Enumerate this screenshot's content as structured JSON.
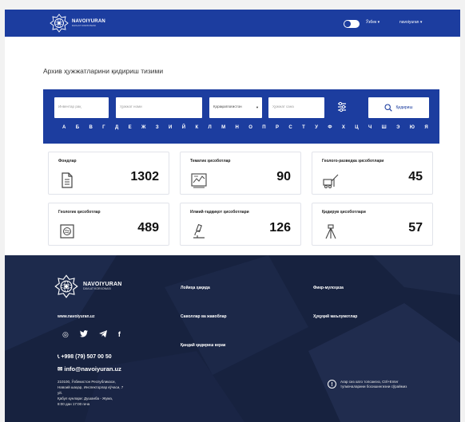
{
  "header": {
    "logo_name": "NAVOIYURAN",
    "logo_subtitle": "DAVLAT KORXONASI",
    "lang_label": "Ўзбек ▾",
    "company_label": "navoiyuran ▾"
  },
  "page_title": "Архив ҳужжатларини қидириш тизими",
  "search": {
    "fields": [
      {
        "placeholder": "Инвентар рақ"
      },
      {
        "placeholder": "Ҳужжат номи"
      },
      {
        "placeholder": "Ҳужжат сана"
      }
    ],
    "select_value": "Қорақалпоғистон",
    "button_label": "Қидириш",
    "letters": [
      "А",
      "Б",
      "В",
      "Г",
      "Д",
      "Е",
      "Ж",
      "З",
      "И",
      "Й",
      "К",
      "Л",
      "М",
      "Н",
      "О",
      "П",
      "Р",
      "С",
      "Т",
      "У",
      "Ф",
      "Х",
      "Ц",
      "Ч",
      "Ш",
      "Э",
      "Ю",
      "Я"
    ]
  },
  "cards": [
    {
      "title": "Фондлар",
      "count": "1302",
      "icon": "document-icon"
    },
    {
      "title": "Тематик ҳисоботлар",
      "count": "90",
      "icon": "report-chart-icon"
    },
    {
      "title": "Геолого-разведка ҳисоботлари",
      "count": "45",
      "icon": "drill-rig-icon"
    },
    {
      "title": "Геологик ҳисоботлар",
      "count": "489",
      "icon": "map-icon"
    },
    {
      "title": "Илмий-тадқиқот ҳисоботлари",
      "count": "126",
      "icon": "microscope-icon"
    },
    {
      "title": "Қидирув ҳисоботлари",
      "count": "57",
      "icon": "tripod-icon"
    }
  ],
  "footer": {
    "logo_name": "NAVOIYURAN",
    "logo_subtitle": "DAVLAT KORXONASI",
    "website": "www.navoiyuran.uz",
    "socials": [
      "instagram-icon",
      "twitter-icon",
      "telegram-icon",
      "facebook-icon"
    ],
    "phone": "+998 (79) 507 00 50",
    "email": "info@navoiyuran.uz",
    "address": [
      "210100, Ўзбекистон Республикаси,",
      "Навоий шаҳар, Инспекторлар кўчаси, 7",
      "уй.",
      "Қабул кунлари: Душанба - Жума,",
      "8:00 дан 17:00 гача"
    ],
    "links": {
      "project": "Лойиҳа ҳақида",
      "faq": "Саволлар ва жавоблар",
      "how_to": "Қандай қидириш керак",
      "feedback": "Фикр-мулоҳаза",
      "legal": "Ҳуқуқий маълумотлар"
    },
    "note": "Агар сиз хато топсангиз, Ctrl+Enter тугмачаларини босишингизни сўраймиз"
  },
  "colors": {
    "brand_blue": "#1c3d9f",
    "footer_dark": "#17223f"
  }
}
